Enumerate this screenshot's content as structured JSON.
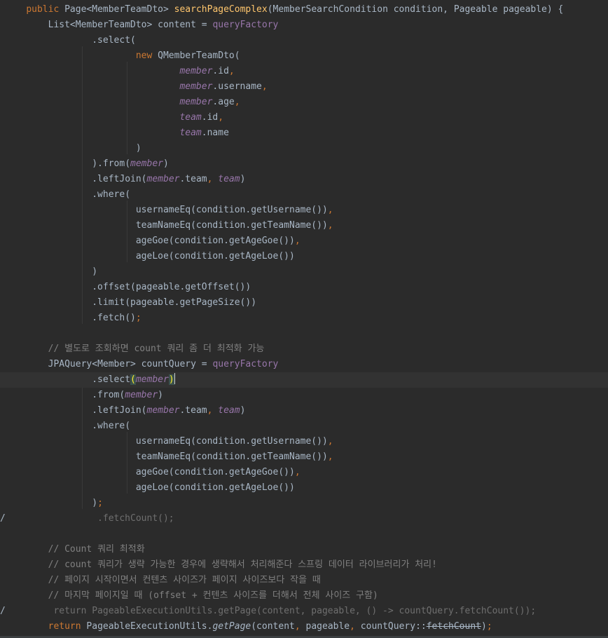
{
  "lines": [
    {
      "indent": "    ",
      "tokens": [
        {
          "t": "public ",
          "c": "kw"
        },
        {
          "t": "Page<MemberTeamDto> "
        },
        {
          "t": "searchPageComplex",
          "c": "fn"
        },
        {
          "t": "(MemberSearchCondition condition, Pageable pageable) {"
        }
      ]
    },
    {
      "indent": "        ",
      "tokens": [
        {
          "t": "List<MemberTeamDto> content = "
        },
        {
          "t": "queryFactory",
          "c": "fld-plain"
        }
      ]
    },
    {
      "indent": "                ",
      "tokens": [
        {
          "t": ".select("
        }
      ]
    },
    {
      "indent": "                        ",
      "tokens": [
        {
          "t": "new ",
          "c": "kw"
        },
        {
          "t": "QMemberTeamDto("
        }
      ]
    },
    {
      "indent": "                                ",
      "tokens": [
        {
          "t": "member",
          "c": "fld"
        },
        {
          "t": ".id"
        },
        {
          "t": ",",
          "c": "kw"
        }
      ]
    },
    {
      "indent": "                                ",
      "tokens": [
        {
          "t": "member",
          "c": "fld"
        },
        {
          "t": ".username"
        },
        {
          "t": ",",
          "c": "kw"
        }
      ]
    },
    {
      "indent": "                                ",
      "tokens": [
        {
          "t": "member",
          "c": "fld"
        },
        {
          "t": ".age"
        },
        {
          "t": ",",
          "c": "kw"
        }
      ]
    },
    {
      "indent": "                                ",
      "tokens": [
        {
          "t": "team",
          "c": "fld"
        },
        {
          "t": ".id"
        },
        {
          "t": ",",
          "c": "kw"
        }
      ]
    },
    {
      "indent": "                                ",
      "tokens": [
        {
          "t": "team",
          "c": "fld"
        },
        {
          "t": ".name"
        }
      ]
    },
    {
      "indent": "                        ",
      "tokens": [
        {
          "t": ")"
        }
      ]
    },
    {
      "indent": "                ",
      "tokens": [
        {
          "t": ").from("
        },
        {
          "t": "member",
          "c": "fld"
        },
        {
          "t": ")"
        }
      ]
    },
    {
      "indent": "                ",
      "tokens": [
        {
          "t": ".leftJoin("
        },
        {
          "t": "member",
          "c": "fld"
        },
        {
          "t": ".team"
        },
        {
          "t": ", ",
          "c": "kw"
        },
        {
          "t": "team",
          "c": "fld"
        },
        {
          "t": ")"
        }
      ]
    },
    {
      "indent": "                ",
      "tokens": [
        {
          "t": ".where("
        }
      ]
    },
    {
      "indent": "                        ",
      "tokens": [
        {
          "t": "usernameEq(condition.getUsername())"
        },
        {
          "t": ",",
          "c": "kw"
        }
      ]
    },
    {
      "indent": "                        ",
      "tokens": [
        {
          "t": "teamNameEq(condition.getTeamName())"
        },
        {
          "t": ",",
          "c": "kw"
        }
      ]
    },
    {
      "indent": "                        ",
      "tokens": [
        {
          "t": "ageGoe(condition.getAgeGoe())"
        },
        {
          "t": ",",
          "c": "kw"
        }
      ]
    },
    {
      "indent": "                        ",
      "tokens": [
        {
          "t": "ageLoe(condition.getAgeLoe())"
        }
      ]
    },
    {
      "indent": "                ",
      "tokens": [
        {
          "t": ")"
        }
      ]
    },
    {
      "indent": "                ",
      "tokens": [
        {
          "t": ".offset(pageable.getOffset())"
        }
      ]
    },
    {
      "indent": "                ",
      "tokens": [
        {
          "t": ".limit(pageable.getPageSize())"
        }
      ]
    },
    {
      "indent": "                ",
      "tokens": [
        {
          "t": ".fetch()"
        },
        {
          "t": ";",
          "c": "kw"
        }
      ]
    },
    {
      "indent": "",
      "tokens": []
    },
    {
      "indent": "        ",
      "tokens": [
        {
          "t": "// 별도로 조회하면 count 쿼리 좀 더 최적화 가능",
          "c": "cm"
        }
      ]
    },
    {
      "indent": "        ",
      "tokens": [
        {
          "t": "JPAQuery<Member> countQuery = "
        },
        {
          "t": "queryFactory",
          "c": "fld-plain"
        }
      ]
    },
    {
      "indent": "                ",
      "current": true,
      "tokens": [
        {
          "t": ".select"
        },
        {
          "t": "(",
          "c": "paren-match"
        },
        {
          "t": "member",
          "c": "fld"
        },
        {
          "t": ")",
          "c": "paren-match"
        },
        {
          "caret": true
        }
      ]
    },
    {
      "indent": "                ",
      "tokens": [
        {
          "t": ".from("
        },
        {
          "t": "member",
          "c": "fld"
        },
        {
          "t": ")"
        }
      ]
    },
    {
      "indent": "                ",
      "tokens": [
        {
          "t": ".leftJoin("
        },
        {
          "t": "member",
          "c": "fld"
        },
        {
          "t": ".team"
        },
        {
          "t": ", ",
          "c": "kw"
        },
        {
          "t": "team",
          "c": "fld"
        },
        {
          "t": ")"
        }
      ]
    },
    {
      "indent": "                ",
      "tokens": [
        {
          "t": ".where("
        }
      ]
    },
    {
      "indent": "                        ",
      "tokens": [
        {
          "t": "usernameEq(condition.getUsername())"
        },
        {
          "t": ",",
          "c": "kw"
        }
      ]
    },
    {
      "indent": "                        ",
      "tokens": [
        {
          "t": "teamNameEq(condition.getTeamName())"
        },
        {
          "t": ",",
          "c": "kw"
        }
      ]
    },
    {
      "indent": "                        ",
      "tokens": [
        {
          "t": "ageGoe(condition.getAgeGoe())"
        },
        {
          "t": ",",
          "c": "kw"
        }
      ]
    },
    {
      "indent": "                        ",
      "tokens": [
        {
          "t": "ageLoe(condition.getAgeLoe())"
        }
      ]
    },
    {
      "indent": "                ",
      "tokens": [
        {
          "t": ")"
        },
        {
          "t": ";",
          "c": "kw"
        }
      ]
    },
    {
      "indent": "",
      "gutter": "/",
      "tokens": [
        {
          "t": "                 .fetchCount();",
          "c": "cm-dim"
        }
      ]
    },
    {
      "indent": "",
      "tokens": []
    },
    {
      "indent": "        ",
      "tokens": [
        {
          "t": "// Count 쿼리 최적화",
          "c": "cm"
        }
      ]
    },
    {
      "indent": "        ",
      "tokens": [
        {
          "t": "// count 쿼리가 생략 가능한 경우에 생략해서 처리해준다 스프링 데이터 라이브러리가 처리!",
          "c": "cm"
        }
      ]
    },
    {
      "indent": "        ",
      "tokens": [
        {
          "t": "// 페이지 시작이면서 컨텐츠 사이즈가 페이지 사이즈보다 작을 때",
          "c": "cm"
        }
      ]
    },
    {
      "indent": "        ",
      "tokens": [
        {
          "t": "// 마지막 페이지일 때 (offset + 컨텐츠 사이즈를 더해서 전체 사이즈 구함)",
          "c": "cm"
        }
      ]
    },
    {
      "indent": "",
      "gutter": "/",
      "tokens": [
        {
          "t": "         return PageableExecutionUtils.getPage(content, pageable, () -> countQuery.fetchCount());",
          "c": "cm-dim"
        }
      ]
    },
    {
      "indent": "        ",
      "tokens": [
        {
          "t": "return ",
          "c": "kw"
        },
        {
          "t": "PageableExecutionUtils."
        },
        {
          "t": "getPage",
          "c": "static-call"
        },
        {
          "t": "(content"
        },
        {
          "t": ", ",
          "c": "kw"
        },
        {
          "t": "pageable"
        },
        {
          "t": ", ",
          "c": "kw"
        },
        {
          "t": "countQuery::"
        },
        {
          "t": "fetchCount",
          "c": "strike"
        },
        {
          "t": ")"
        },
        {
          "t": ";",
          "c": "kw"
        }
      ]
    }
  ]
}
